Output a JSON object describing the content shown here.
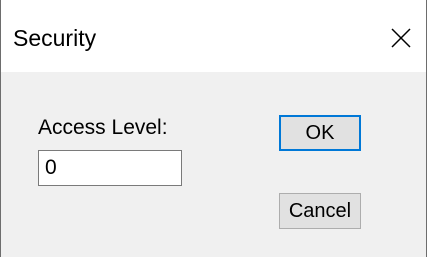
{
  "window": {
    "title": "Security",
    "close_icon": "close-icon"
  },
  "form": {
    "access_level_label": "Access Level:",
    "access_level_value": "0"
  },
  "buttons": {
    "ok_label": "OK",
    "cancel_label": "Cancel"
  },
  "colors": {
    "default_button_border": "#0078d7",
    "button_face": "#e1e1e1",
    "client_background": "#f0f0f0"
  }
}
